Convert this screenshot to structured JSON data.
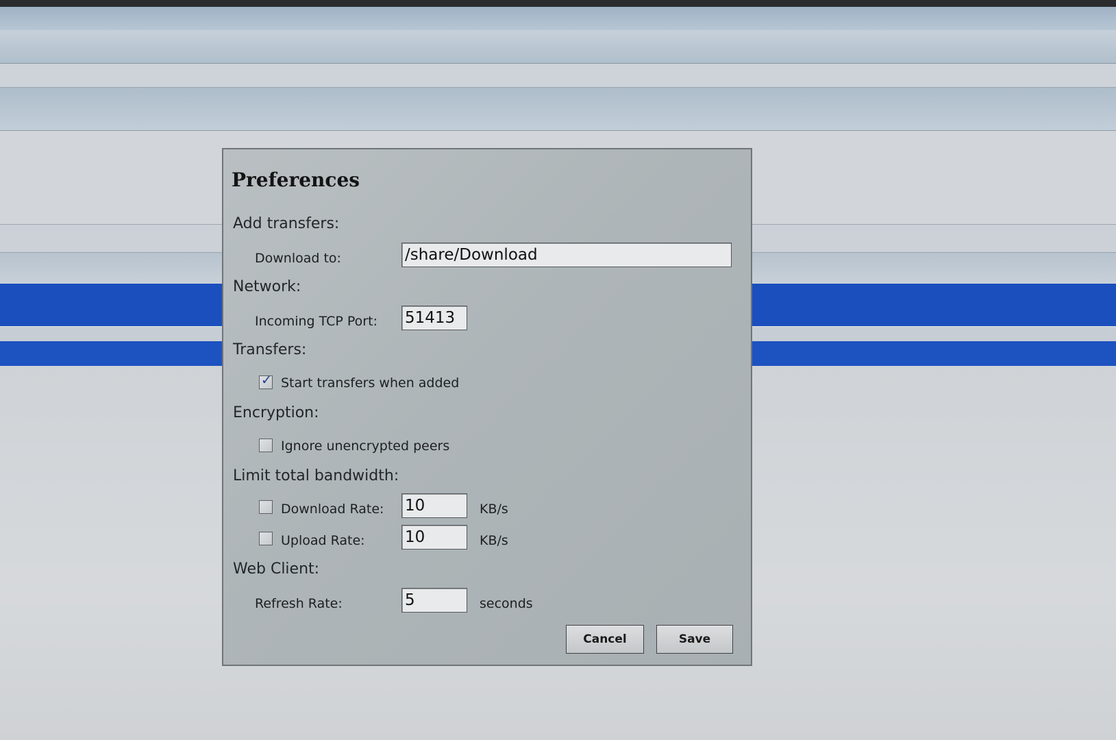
{
  "dialog": {
    "title": "Preferences",
    "sections": {
      "add_transfers": "Add transfers:",
      "network": "Network:",
      "transfers": "Transfers:",
      "encryption": "Encryption:",
      "limit_bandwidth": "Limit total bandwidth:",
      "web_client": "Web Client:"
    },
    "fields": {
      "download_to_label": "Download to:",
      "download_to_value": "/share/Download",
      "tcp_port_label": "Incoming TCP Port:",
      "tcp_port_value": "51413",
      "start_transfers_label": "Start transfers when added",
      "start_transfers_checked": true,
      "ignore_unencrypted_label": "Ignore unencrypted peers",
      "ignore_unencrypted_checked": false,
      "download_rate_label": "Download Rate:",
      "download_rate_value": "10",
      "download_rate_checked": false,
      "upload_rate_label": "Upload Rate:",
      "upload_rate_value": "10",
      "upload_rate_checked": false,
      "rate_unit": "KB/s",
      "refresh_rate_label": "Refresh Rate:",
      "refresh_rate_value": "5",
      "refresh_rate_unit": "seconds"
    },
    "buttons": {
      "cancel": "Cancel",
      "save": "Save"
    },
    "tick_glyph": "✓"
  },
  "colors": {
    "selection_blue": "#1b4fbd",
    "dialog_bg": "#b0b7ba"
  }
}
